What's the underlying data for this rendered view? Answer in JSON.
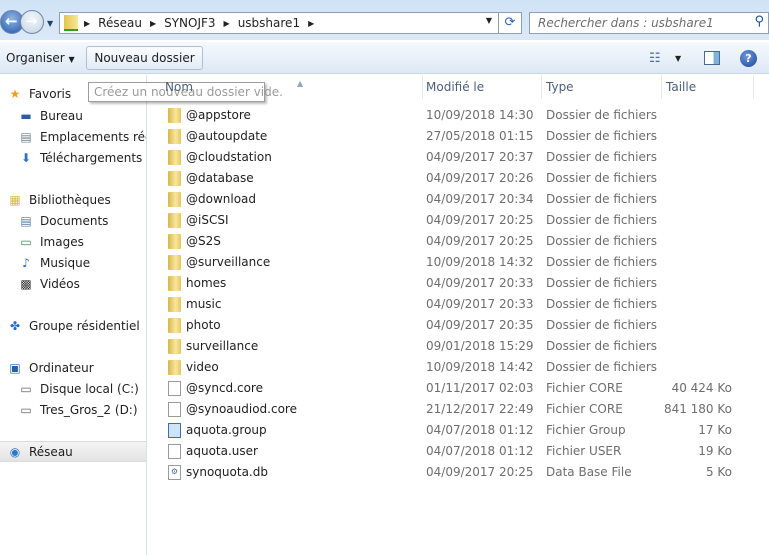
{
  "address": {
    "crumbs": [
      "Réseau",
      "SYNOJF3",
      "usbshare1"
    ]
  },
  "search": {
    "placeholder": "Rechercher dans : usbshare1"
  },
  "toolbar": {
    "organize": "Organiser",
    "new_folder": "Nouveau dossier",
    "tooltip": "Créez un nouveau dossier vide."
  },
  "sidebar": {
    "items": [
      {
        "label": "Favoris",
        "icon": "star-icon",
        "level": "top"
      },
      {
        "label": "Bureau",
        "icon": "desktop-icon",
        "level": "sub"
      },
      {
        "label": "Emplacements récents",
        "icon": "recent-places-icon",
        "level": "sub"
      },
      {
        "label": "Téléchargements",
        "icon": "downloads-icon",
        "level": "sub"
      },
      {
        "label": "Bibliothèques",
        "icon": "libraries-icon",
        "level": "top"
      },
      {
        "label": "Documents",
        "icon": "documents-icon",
        "level": "sub"
      },
      {
        "label": "Images",
        "icon": "pictures-icon",
        "level": "sub"
      },
      {
        "label": "Musique",
        "icon": "music-icon",
        "level": "sub"
      },
      {
        "label": "Vidéos",
        "icon": "videos-icon",
        "level": "sub"
      },
      {
        "label": "Groupe résidentiel",
        "icon": "homegroup-icon",
        "level": "top"
      },
      {
        "label": "Ordinateur",
        "icon": "computer-icon",
        "level": "top"
      },
      {
        "label": "Disque local (C:)",
        "icon": "drive-icon",
        "level": "sub"
      },
      {
        "label": "Tres_Gros_2 (D:)",
        "icon": "drive-icon",
        "level": "sub"
      },
      {
        "label": "Réseau",
        "icon": "network-icon",
        "level": "top"
      }
    ]
  },
  "columns": {
    "name": "Nom",
    "date": "Modifié le",
    "type": "Type",
    "size": "Taille"
  },
  "files": [
    {
      "name": "@appstore",
      "date": "10/09/2018 14:30",
      "type": "Dossier de fichiers",
      "size": "",
      "kind": "folder"
    },
    {
      "name": "@autoupdate",
      "date": "27/05/2018 01:15",
      "type": "Dossier de fichiers",
      "size": "",
      "kind": "folder"
    },
    {
      "name": "@cloudstation",
      "date": "04/09/2017 20:37",
      "type": "Dossier de fichiers",
      "size": "",
      "kind": "folder"
    },
    {
      "name": "@database",
      "date": "04/09/2017 20:26",
      "type": "Dossier de fichiers",
      "size": "",
      "kind": "folder"
    },
    {
      "name": "@download",
      "date": "04/09/2017 20:34",
      "type": "Dossier de fichiers",
      "size": "",
      "kind": "folder"
    },
    {
      "name": "@iSCSI",
      "date": "04/09/2017 20:25",
      "type": "Dossier de fichiers",
      "size": "",
      "kind": "folder"
    },
    {
      "name": "@S2S",
      "date": "04/09/2017 20:25",
      "type": "Dossier de fichiers",
      "size": "",
      "kind": "folder"
    },
    {
      "name": "@surveillance",
      "date": "10/09/2018 14:32",
      "type": "Dossier de fichiers",
      "size": "",
      "kind": "folder"
    },
    {
      "name": "homes",
      "date": "04/09/2017 20:33",
      "type": "Dossier de fichiers",
      "size": "",
      "kind": "folder"
    },
    {
      "name": "music",
      "date": "04/09/2017 20:33",
      "type": "Dossier de fichiers",
      "size": "",
      "kind": "folder"
    },
    {
      "name": "photo",
      "date": "04/09/2017 20:35",
      "type": "Dossier de fichiers",
      "size": "",
      "kind": "folder"
    },
    {
      "name": "surveillance",
      "date": "09/01/2018 15:29",
      "type": "Dossier de fichiers",
      "size": "",
      "kind": "folder"
    },
    {
      "name": "video",
      "date": "10/09/2018 14:42",
      "type": "Dossier de fichiers",
      "size": "",
      "kind": "folder"
    },
    {
      "name": "@syncd.core",
      "date": "01/11/2017 02:03",
      "type": "Fichier CORE",
      "size": "40 424 Ko",
      "kind": "file"
    },
    {
      "name": "@synoaudiod.core",
      "date": "21/12/2017 22:49",
      "type": "Fichier CORE",
      "size": "841 180 Ko",
      "kind": "file"
    },
    {
      "name": "aquota.group",
      "date": "04/07/2018 01:12",
      "type": "Fichier Group",
      "size": "17 Ko",
      "kind": "grp"
    },
    {
      "name": "aquota.user",
      "date": "04/07/2018 01:12",
      "type": "Fichier USER",
      "size": "19 Ko",
      "kind": "file"
    },
    {
      "name": "synoquota.db",
      "date": "04/09/2017 20:25",
      "type": "Data Base File",
      "size": "5 Ko",
      "kind": "db"
    }
  ]
}
